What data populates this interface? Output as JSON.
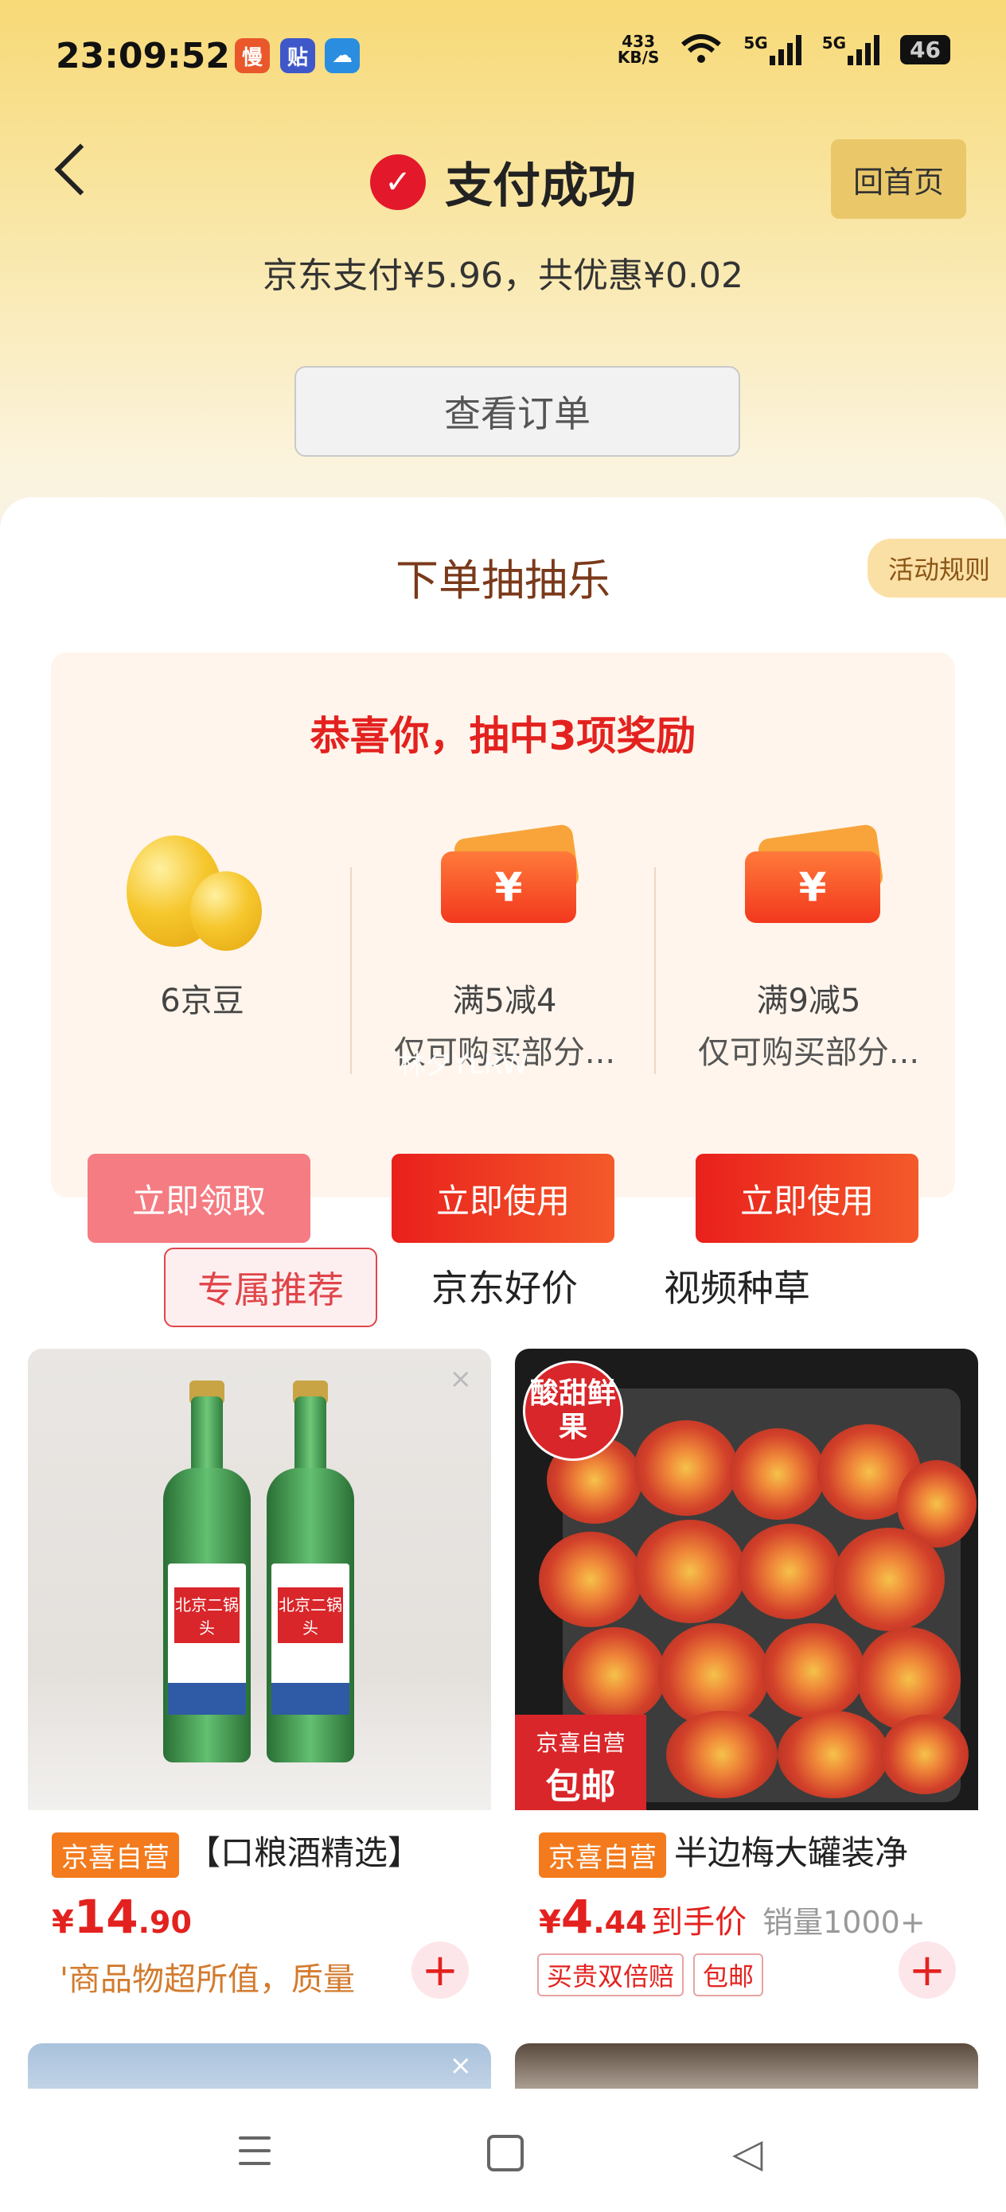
{
  "status_bar": {
    "time": "23:09:52",
    "app_icons": [
      "慢",
      "贴",
      "☁"
    ],
    "net_speed_value": "433",
    "net_speed_unit": "KB/S",
    "sig1": "5G",
    "sig2": "5G",
    "battery": "46"
  },
  "header": {
    "title": "支付成功",
    "home_label": "回首页",
    "pay_info": "京东支付¥5.96，共优惠¥0.02",
    "order_button": "查看订单"
  },
  "lottery": {
    "title": "下单抽抽乐",
    "rules_label": "活动规则",
    "congrats": "恭喜你，抽中3项奖励",
    "prizes": [
      {
        "label": "6京豆",
        "sub": "",
        "button": "立即领取"
      },
      {
        "label": "满5减4",
        "sub": "仅可购买部分...",
        "button": "立即使用"
      },
      {
        "label": "满9减5",
        "sub": "仅可购买部分...",
        "button": "立即使用"
      }
    ],
    "coupon_symbol": "¥",
    "watermark": "林夕YLRW"
  },
  "tabs": [
    "专属推荐",
    "京东好价",
    "视频种草"
  ],
  "products": [
    {
      "tag": "京喜自营",
      "title": "【口粮酒精选】",
      "price_yen": "¥",
      "price_int": "14",
      "price_dec": ".90",
      "desc": "'商品物超所值，质量",
      "bottle_label": "北京二锅头"
    },
    {
      "tag": "京喜自营",
      "title": "半边梅大罐装净",
      "price_yen": "¥",
      "price_int": "4",
      "price_dec": ".44",
      "price_suffix": "到手价",
      "sales": "销量1000+",
      "chips": [
        "买贵双倍赔",
        "包邮"
      ],
      "badge_top": "酸甜鲜果",
      "badge_bottom_a": "京喜自营",
      "badge_bottom_b": "包邮"
    }
  ],
  "close_symbol": "×",
  "plus_symbol": "+",
  "colors": {
    "accent": "#e3221f",
    "header_gold": "#f8d977",
    "tag_orange": "#f37b1d"
  }
}
